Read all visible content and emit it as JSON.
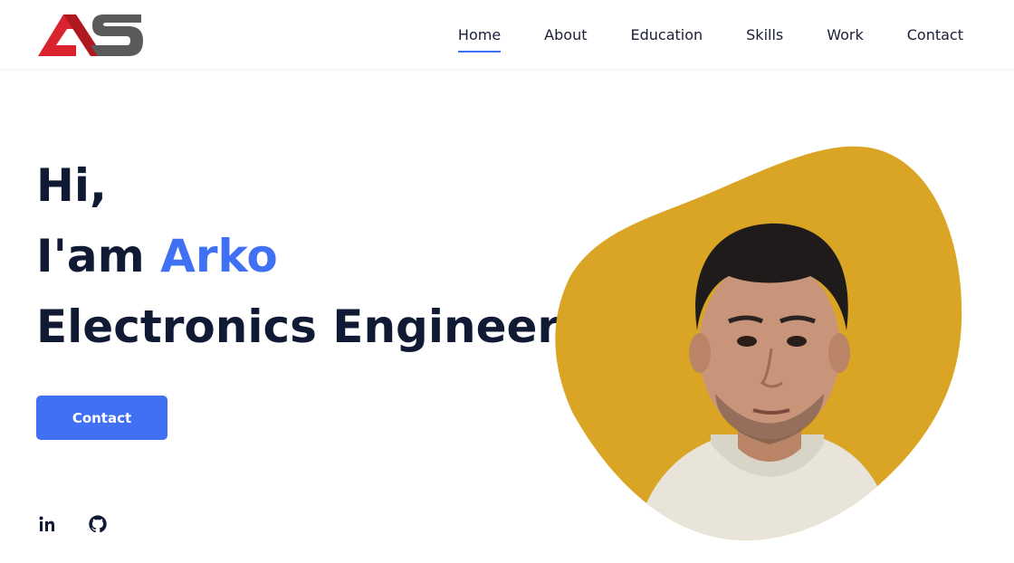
{
  "brand": {
    "logo_text": "AS"
  },
  "nav": {
    "items": [
      {
        "label": "Home",
        "active": true
      },
      {
        "label": "About"
      },
      {
        "label": "Education"
      },
      {
        "label": "Skills"
      },
      {
        "label": "Work"
      },
      {
        "label": "Contact"
      }
    ]
  },
  "hero": {
    "greeting": "Hi,",
    "intro_prefix": "I'am ",
    "name": "Arko",
    "title": "Electronics Engineer",
    "cta_label": "Contact"
  },
  "socials": [
    {
      "icon": "linkedin-icon"
    },
    {
      "icon": "github-icon"
    }
  ],
  "colors": {
    "accent": "#4070f4",
    "heading": "#111a35",
    "blob": "#daa525",
    "logo_red": "#d9232e",
    "logo_gray": "#555555"
  }
}
